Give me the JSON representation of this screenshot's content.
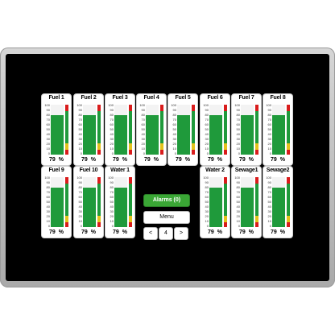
{
  "scale_labels": [
    "100",
    "90",
    "80",
    "70",
    "60",
    "50",
    "40",
    "30",
    "20",
    "10",
    "0"
  ],
  "tanks": [
    {
      "name": "Fuel 1",
      "value": "79",
      "unit": "%",
      "level": 79
    },
    {
      "name": "Fuel 2",
      "value": "79",
      "unit": "%",
      "level": 79
    },
    {
      "name": "Fuel 3",
      "value": "79",
      "unit": "%",
      "level": 79
    },
    {
      "name": "Fuel 4",
      "value": "79",
      "unit": "%",
      "level": 79
    },
    {
      "name": "Fuel 5",
      "value": "79",
      "unit": "%",
      "level": 79
    },
    {
      "name": "Fuel 6",
      "value": "79",
      "unit": "%",
      "level": 79
    },
    {
      "name": "Fuel 7",
      "value": "79",
      "unit": "%",
      "level": 79
    },
    {
      "name": "Fuel 8",
      "value": "79",
      "unit": "%",
      "level": 79
    },
    {
      "name": "Fuel 9",
      "value": "79",
      "unit": "%",
      "level": 79
    },
    {
      "name": "Fuel 10",
      "value": "79",
      "unit": "%",
      "level": 79
    },
    {
      "name": "Water 1",
      "value": "79",
      "unit": "%",
      "level": 79
    },
    {
      "name": "Water 2",
      "value": "79",
      "unit": "%",
      "level": 79
    },
    {
      "name": "Sewage1",
      "value": "79",
      "unit": "%",
      "level": 79
    },
    {
      "name": "Sewage2",
      "value": "79",
      "unit": "%",
      "level": 79
    }
  ],
  "controls": {
    "alarms_label": "Alarms (0)",
    "menu_label": "Menu",
    "prev_label": "<",
    "page_number": "4",
    "next_label": ">"
  },
  "colors": {
    "fill": "#1f9a3b",
    "alarm_button": "#3aa635",
    "lamp_red": "#d91c1c",
    "lamp_yellow": "#e3c21b",
    "lamp_green": "#1f9a3b"
  }
}
